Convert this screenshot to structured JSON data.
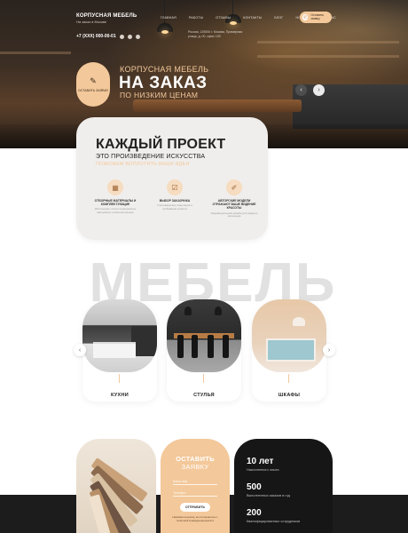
{
  "header": {
    "brand_name": "КОРПУСНАЯ МЕБЕЛЬ",
    "brand_tagline": "На заказ в Москве",
    "nav": [
      "Главная",
      "Работы",
      "Отзывы",
      "Контакты",
      "Блог",
      "Новости",
      "О нас"
    ],
    "order_button": "Оставить заявку",
    "phone": "+7 (XXX) 000-00-01",
    "address": "Россия, 125000 г. Москва, Примерная улица, д. 00, офис 100"
  },
  "hero": {
    "subtitle_top": "КОРПУСНАЯ МЕБЕЛЬ",
    "title": "НА ЗАКАЗ",
    "subtitle_bottom": "ПО НИЗКИМ ЦЕНАМ",
    "cta_label": "Оставить заявку",
    "prev_icon": "‹",
    "next_icon": "›"
  },
  "project": {
    "title": "КАЖДЫЙ ПРОЕКТ",
    "subtitle": "ЭТО ПРОИЗВЕДЕНИЕ ИСКУССТВА",
    "accent": "ПОМОЖЕМ ВОПЛОТИТЬ ВАШИ ИДЕИ",
    "features": [
      {
        "icon": "materials-icon",
        "title": "ОТБОРНЫЕ МАТЕРИАЛЫ И КОМПЛЕКТУЮЩИЕ",
        "desc": "Используем только проверенные материалы и комплектующие"
      },
      {
        "icon": "client-icon",
        "title": "ВЫБОР ЗАКАЗЧИКА",
        "desc": "Учитываем все пожелания и требования клиента"
      },
      {
        "icon": "design-icon",
        "title": "АВТОРСКИЕ МОДЕЛИ ОТРАЖАЮТ ВАШЕ ВИДЕНИЕ КРАСОТЫ",
        "desc": "Индивидуальный дизайн для каждого интерьера"
      }
    ]
  },
  "furniture": {
    "heading": "МЕБЕЛЬ",
    "categories": [
      {
        "label": "КУХНИ",
        "image": "kitchen"
      },
      {
        "label": "СТУЛЬЯ",
        "image": "chairs"
      },
      {
        "label": "ШКАФЫ",
        "image": "wardrobe"
      }
    ]
  },
  "order_form": {
    "heading_1": "ОСТАВИТЬ",
    "heading_2": "ЗАЯВКУ",
    "name_placeholder": "Ваше имя",
    "phone_placeholder": "Телефон",
    "submit_label": "ОТПРАВИТЬ",
    "agree_text": "Нажимая на кнопку, вы соглашаетесь с политикой конфиденциальности"
  },
  "stats": [
    {
      "number": "10 лет",
      "label": "Накопленного опыта"
    },
    {
      "number": "500",
      "label": "Выполненных заказов в год"
    },
    {
      "number": "200",
      "label": "Квалифицированных сотрудников"
    }
  ],
  "colors": {
    "accent": "#f3c89a",
    "dark": "#161616",
    "card_bg": "#f0eeec"
  }
}
